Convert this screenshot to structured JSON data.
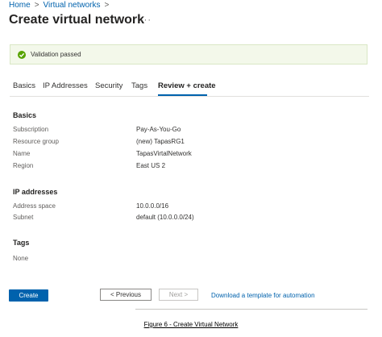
{
  "breadcrumb": {
    "home": "Home",
    "separator": ">",
    "current": "Virtual networks"
  },
  "header": {
    "title": "Create virtual network",
    "more": "···"
  },
  "banner": {
    "text": "Validation passed"
  },
  "tabs": [
    {
      "label": "Basics"
    },
    {
      "label": "IP Addresses"
    },
    {
      "label": "Security"
    },
    {
      "label": "Tags"
    },
    {
      "label": "Review + create"
    }
  ],
  "basics": {
    "heading": "Basics",
    "rows": [
      {
        "label": "Subscription",
        "value": "Pay-As-You-Go"
      },
      {
        "label": "Resource group",
        "value": "(new) TapasRG1"
      },
      {
        "label": "Name",
        "value": "TapasVirtalNetwork"
      },
      {
        "label": "Region",
        "value": "East US 2"
      }
    ]
  },
  "ip": {
    "heading": "IP addresses",
    "rows": [
      {
        "label": "Address space",
        "value": "10.0.0.0/16"
      },
      {
        "label": "Subnet",
        "value": "default (10.0.0.0/24)"
      }
    ]
  },
  "tags": {
    "heading": "Tags",
    "value": "None"
  },
  "footer": {
    "create": "Create",
    "previous": "< Previous",
    "next": "Next >",
    "download": "Download a template for automation"
  },
  "caption": "Figure 6 - Create Virtual Network",
  "colors": {
    "accent": "#0062ad",
    "success": "#57a300",
    "banner_bg": "#f3f8ea"
  }
}
